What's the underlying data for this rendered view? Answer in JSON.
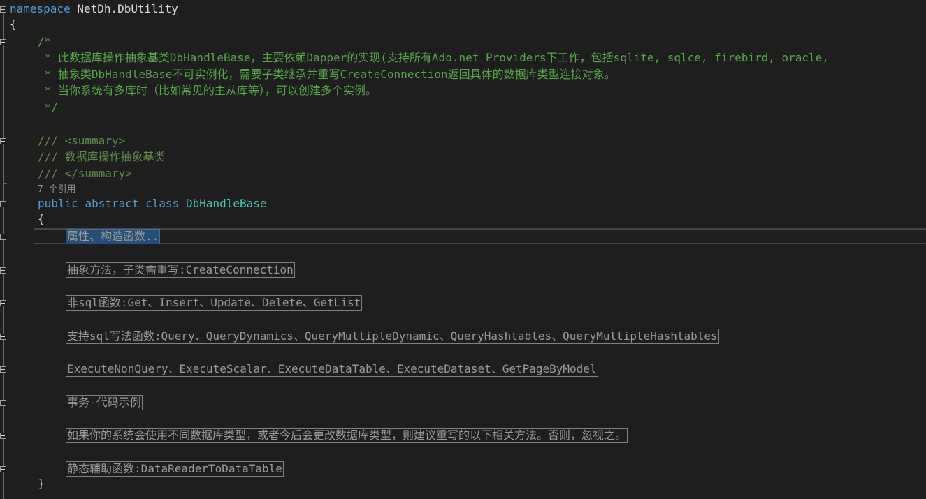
{
  "code": {
    "namespace_kw": "namespace",
    "namespace_name": "NetDh.DbUtility",
    "open_brace": "{",
    "close_brace": "}",
    "comment_lines": [
      "/*",
      " * 此数据库操作抽象基类DbHandleBase，主要依赖Dapper的实现(支持所有Ado.net Providers下工作，包括sqlite, sqlce, firebird, oracle,",
      " * 抽象类DbHandleBase不可实例化，需要子类继承并重写CreateConnection返回具体的数据库类型连接对象。",
      " * 当你系统有多库时（比如常见的主从库等），可以创建多个实例。",
      " */"
    ],
    "doc_summary_open_prefix": "/// ",
    "doc_summary_open_tag": "<summary>",
    "doc_summary_text": "/// 数据库操作抽象基类",
    "doc_summary_close_prefix": "/// ",
    "doc_summary_close_tag": "</summary>",
    "codelens": "7 个引用",
    "class_kw_public": "public",
    "class_kw_abstract": "abstract",
    "class_kw_class": "class",
    "class_name": "DbHandleBase",
    "regions": [
      "属性、构造函数..",
      "抽象方法，子类需重写:CreateConnection",
      "非sql函数:Get、Insert、Update、Delete、GetList",
      "支持sql写法函数:Query、QueryDynamics、QueryMultipleDynamic、QueryHashtables、QueryMultipleHashtables",
      "ExecuteNonQuery、ExecuteScalar、ExecuteDataTable、ExecuteDataset、GetPageByModel",
      "事务-代码示例",
      "如果你的系统会使用不同数据库类型，或者今后会更改数据库类型，则建议重写的以下相关方法。否则，忽视之。",
      "静态辅助函数:DataReaderToDataTable"
    ]
  },
  "selected_region_index": 0
}
